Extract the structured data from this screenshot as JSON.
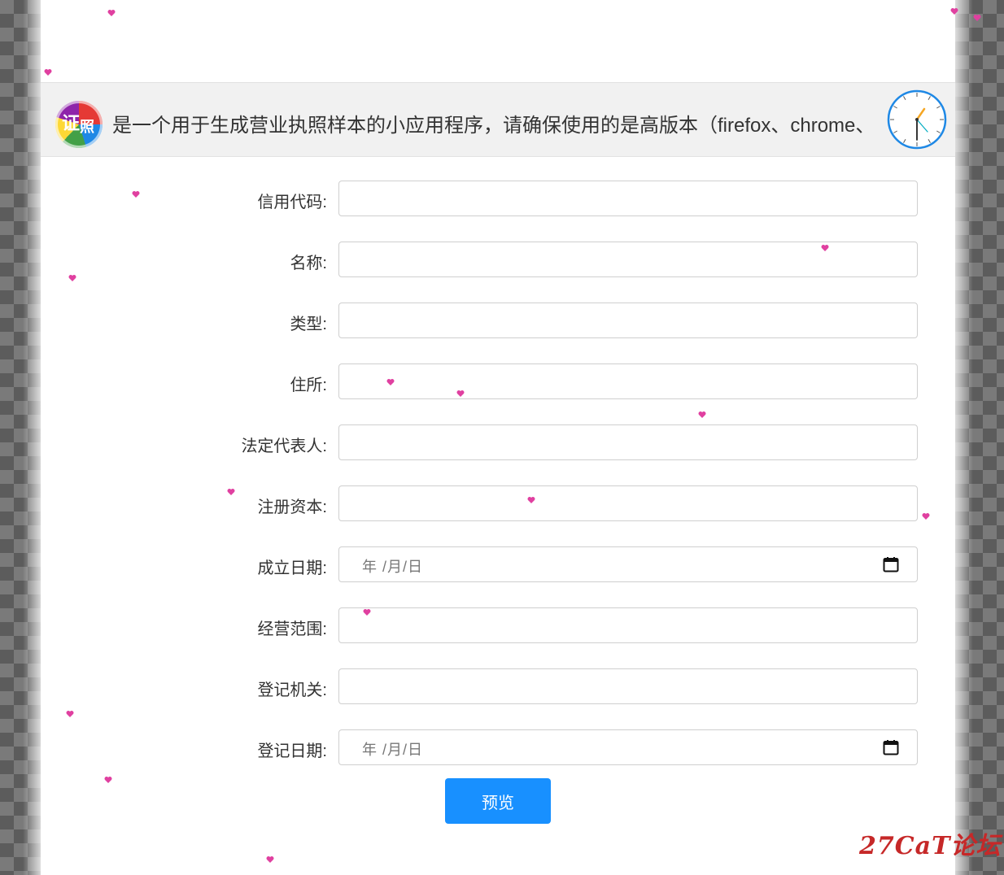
{
  "banner": {
    "logo_icon": "colorful-sphere-logo",
    "marquee_text": "是一个用于生成营业执照样本的小应用程序，请确保使用的是高版本（firefox、chrome、"
  },
  "form": {
    "fields": [
      {
        "label": "信用代码:",
        "type": "text",
        "value": ""
      },
      {
        "label": "名称:",
        "type": "text",
        "value": ""
      },
      {
        "label": "类型:",
        "type": "text",
        "value": ""
      },
      {
        "label": "住所:",
        "type": "text",
        "value": ""
      },
      {
        "label": "法定代表人:",
        "type": "text",
        "value": ""
      },
      {
        "label": "注册资本:",
        "type": "text",
        "value": ""
      },
      {
        "label": "成立日期:",
        "type": "date",
        "placeholder": "年 /月/日"
      },
      {
        "label": "经营范围:",
        "type": "text",
        "value": ""
      },
      {
        "label": "登记机关:",
        "type": "text",
        "value": ""
      },
      {
        "label": "登记日期:",
        "type": "date",
        "placeholder": "年 /月/日"
      }
    ],
    "preview_label": "预览"
  },
  "watermark": "27CaT论坛",
  "colors": {
    "accent": "#1890ff",
    "heart": "#e040a0",
    "banner_bg": "#f1f1f1",
    "watermark": "#c62828"
  }
}
